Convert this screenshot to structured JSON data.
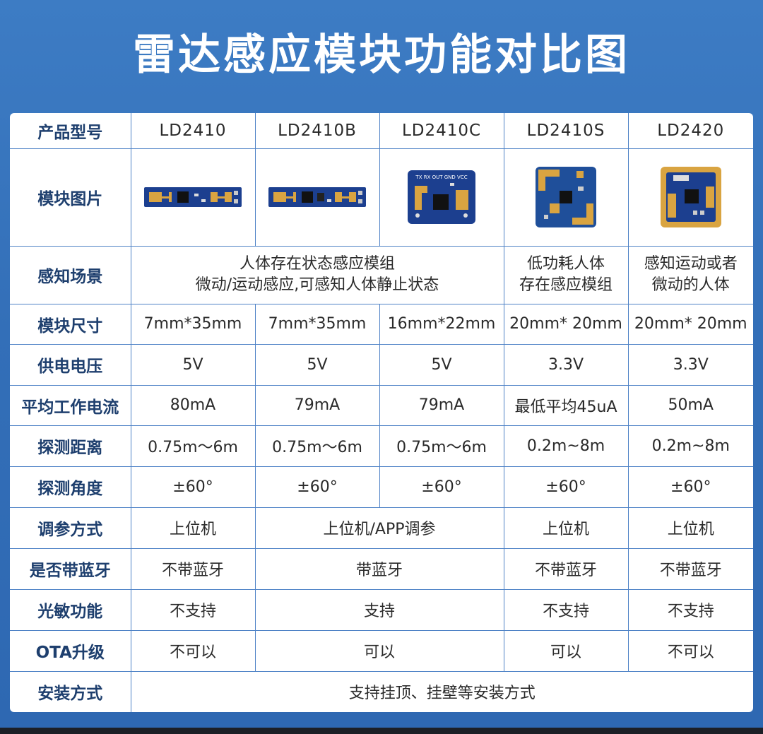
{
  "title": "雷达感应模块功能对比图",
  "header": {
    "label": "产品型号",
    "models": [
      "LD2410",
      "LD2410B",
      "LD2410C",
      "LD2410S",
      "LD2420"
    ]
  },
  "rows": {
    "image": {
      "label": "模块图片"
    },
    "scene": {
      "label": "感知场景",
      "group1_line1": "人体存在状态感应模组",
      "group1_line2": "微动/运动感应,可感知人体静止状态",
      "ld2410s_line1": "低功耗人体",
      "ld2410s_line2": "存在感应模组",
      "ld2420_line1": "感知运动或者",
      "ld2420_line2": "微动的人体"
    },
    "size": {
      "label": "模块尺寸",
      "values": [
        "7mm*35mm",
        "7mm*35mm",
        "16mm*22mm",
        "20mm* 20mm",
        "20mm* 20mm"
      ]
    },
    "voltage": {
      "label": "供电电压",
      "values": [
        "5V",
        "5V",
        "5V",
        "3.3V",
        "3.3V"
      ]
    },
    "current": {
      "label": "平均工作电流",
      "values": [
        "80mA",
        "79mA",
        "79mA",
        "最低平均45uA",
        "50mA"
      ]
    },
    "distance": {
      "label": "探测距离",
      "values": [
        "0.75m～6m",
        "0.75m～6m",
        "0.75m～6m",
        "0.2m~8m",
        "0.2m~8m"
      ]
    },
    "angle": {
      "label": "探测角度",
      "values": [
        "±60°",
        "±60°",
        "±60°",
        "±60°",
        "±60°"
      ]
    },
    "tuning": {
      "label": "调参方式",
      "ld2410": "上位机",
      "group": "上位机/APP调参",
      "ld2410s": "上位机",
      "ld2420": "上位机"
    },
    "bluetooth": {
      "label": "是否带蓝牙",
      "ld2410": "不带蓝牙",
      "group": "带蓝牙",
      "ld2410s": "不带蓝牙",
      "ld2420": "不带蓝牙"
    },
    "light": {
      "label": "光敏功能",
      "ld2410": "不支持",
      "group": "支持",
      "ld2410s": "不支持",
      "ld2420": "不支持"
    },
    "ota": {
      "label": "OTA升级",
      "ld2410": "不可以",
      "group": "可以",
      "ld2410s": "可以",
      "ld2420": "不可以"
    },
    "install": {
      "label": "安装方式",
      "value": "支持挂顶、挂壁等安装方式"
    }
  },
  "board_c_silkscreen": "TX RX OUT GND VCC",
  "colors": {
    "background": "#336fb8",
    "border": "#4e82c6",
    "label_text": "#1e3f6e",
    "pcb_blue": "#1c3f8f",
    "pcb_gold": "#d9a441"
  }
}
